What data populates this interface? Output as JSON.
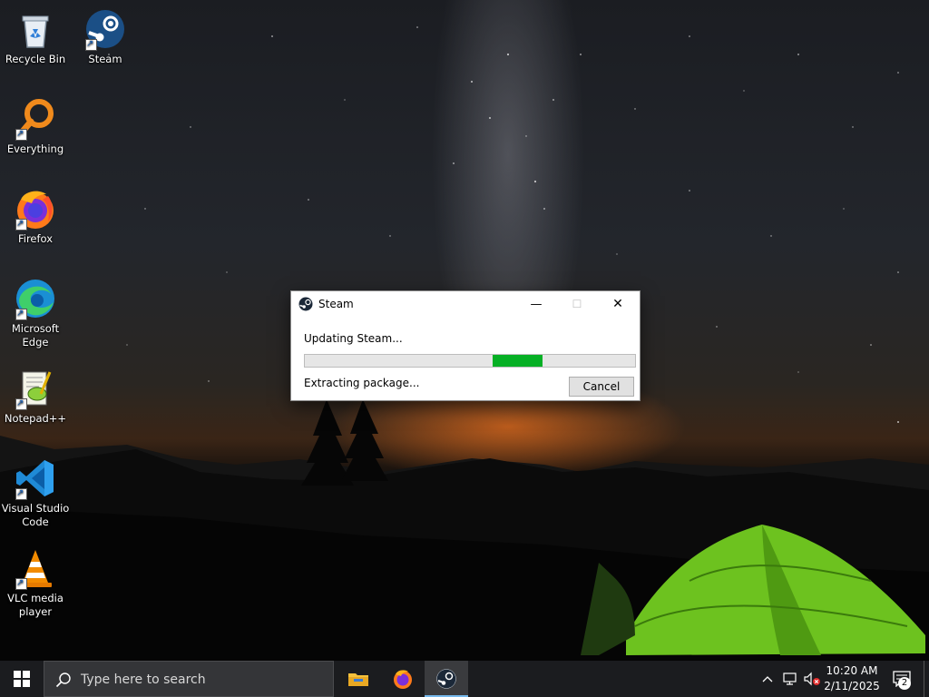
{
  "desktop": {
    "icons": [
      {
        "label": "Recycle Bin"
      },
      {
        "label": "Steam"
      },
      {
        "label": "Everything"
      },
      {
        "label": "Firefox"
      },
      {
        "label": "Microsoft Edge"
      },
      {
        "label": "Notepad++"
      },
      {
        "label": "Visual Studio Code"
      },
      {
        "label": "VLC media player"
      }
    ]
  },
  "dialog": {
    "title": "Steam",
    "status": "Updating Steam...",
    "detail": "Extracting package...",
    "cancel_label": "Cancel",
    "progress_fraction": 0.72,
    "progress_fill_start_fraction": 0.57,
    "minimize_glyph": "—",
    "maximize_glyph": "☐",
    "close_glyph": "✕"
  },
  "taskbar": {
    "search_placeholder": "Type here to search",
    "apps": [
      "file-explorer",
      "firefox",
      "steam"
    ],
    "active_app": "steam",
    "time": "10:20 AM",
    "date": "2/11/2025",
    "notification_count": "2"
  },
  "colors": {
    "progress_fill": "#06b025",
    "taskbar_bg": "#1b1c1f",
    "active_indicator": "#76b9ed"
  }
}
